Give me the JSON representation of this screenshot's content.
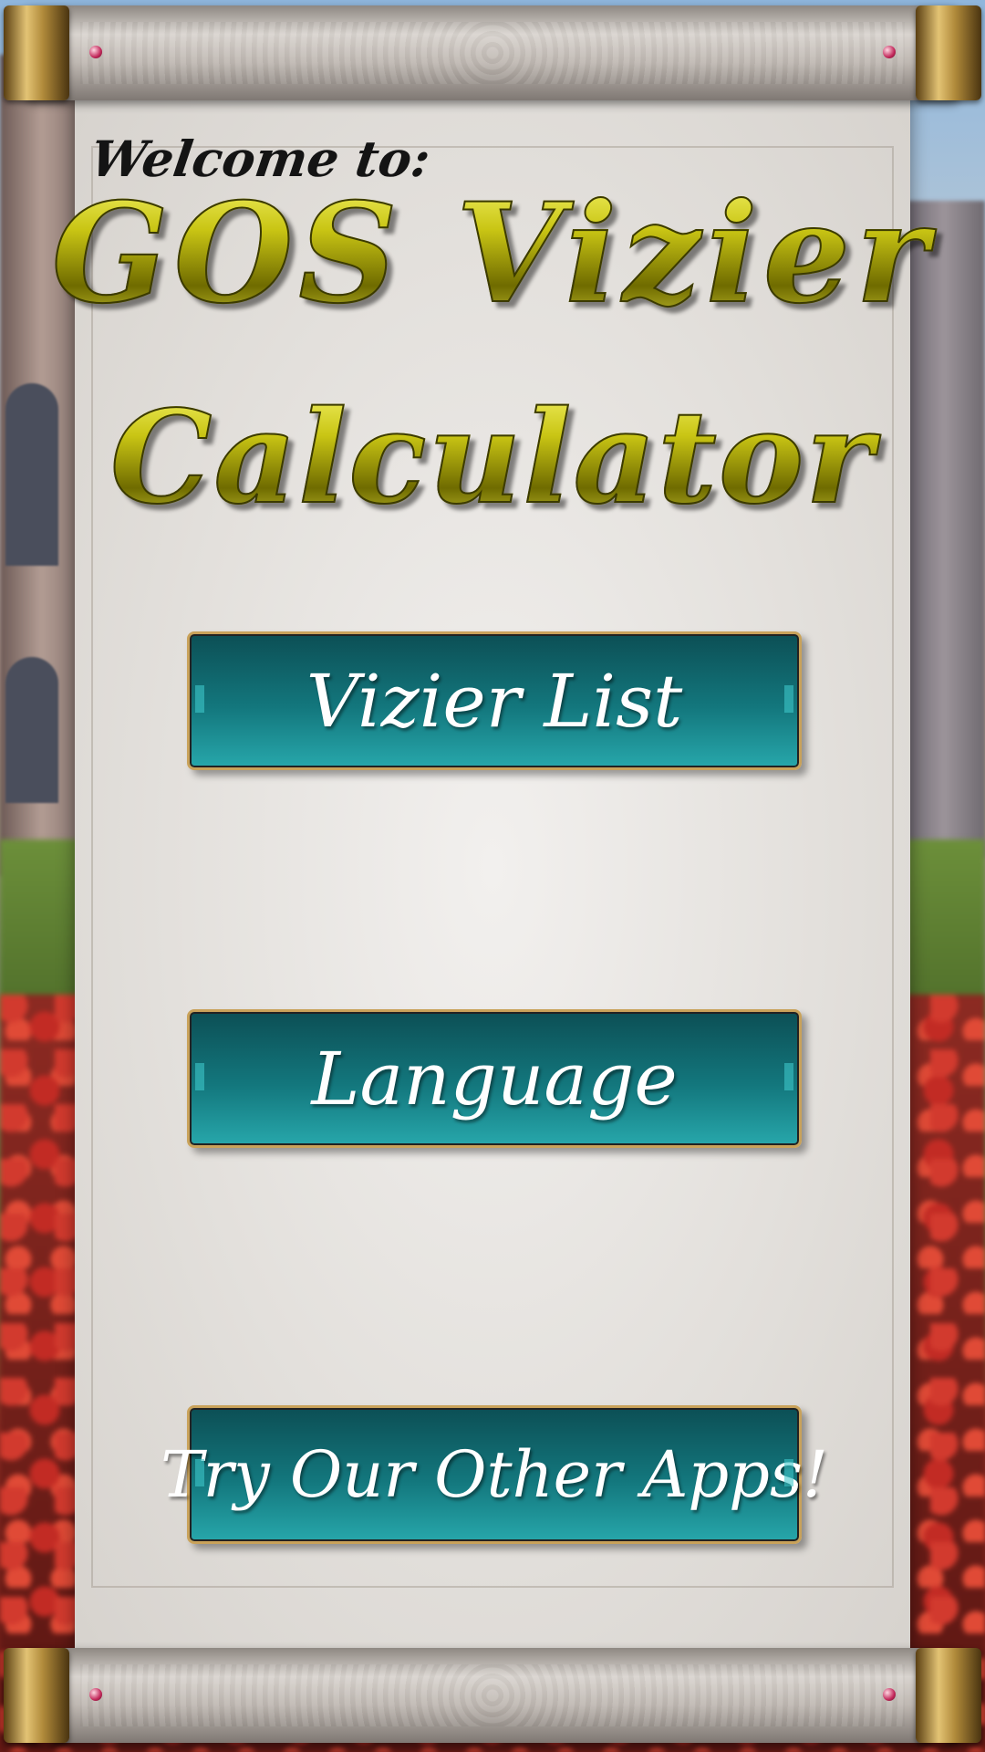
{
  "header": {
    "welcome": "Welcome to:",
    "title_line1": "GOS Vizier",
    "title_line2": "Calculator"
  },
  "menu": {
    "vizier_list": "Vizier List",
    "language": "Language",
    "other_apps": "Try Our Other Apps!"
  },
  "colors": {
    "button": "#13777d",
    "button_border": "#c9a25a",
    "title_gold": "#c9c514",
    "parchment": "#e3e0dc"
  }
}
